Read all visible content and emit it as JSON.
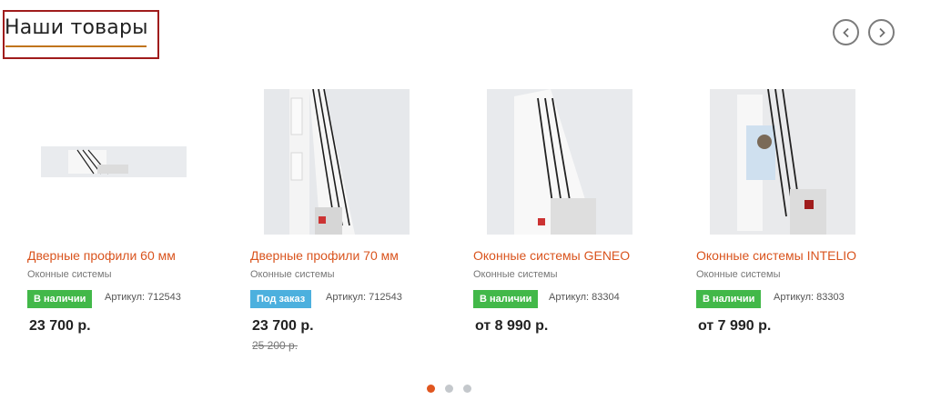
{
  "header": {
    "title": "Наши товары"
  },
  "nav": {
    "prev_icon": "chevron-left-icon",
    "next_icon": "chevron-right-icon"
  },
  "products": [
    {
      "name": "Дверные профили 60 мм",
      "category": "Оконные системы",
      "stock": "В наличии",
      "stock_color": "#42b849",
      "sku_label": "Артикул: 712543",
      "price": "23 700 р.",
      "old_price": ""
    },
    {
      "name": "Дверные профили 70 мм",
      "category": "Оконные системы",
      "stock": "Под заказ",
      "stock_color": "#4cb0de",
      "sku_label": "Артикул: 712543",
      "price": "23 700 р.",
      "old_price": "25 200 р."
    },
    {
      "name": "Оконные системы GENEO",
      "category": "Оконные системы",
      "stock": "В наличии",
      "stock_color": "#42b849",
      "sku_label": "Артикул: 83304",
      "price": "от 8 990 р.",
      "old_price": ""
    },
    {
      "name": "Оконные системы INTELIO",
      "category": "Оконные системы",
      "stock": "В наличии",
      "stock_color": "#42b849",
      "sku_label": "Артикул: 83303",
      "price": "от 7 990 р.",
      "old_price": ""
    }
  ],
  "colors": {
    "accent": "#d9541e",
    "title_border": "#a01c1c",
    "active_dot": "#e0561f"
  }
}
